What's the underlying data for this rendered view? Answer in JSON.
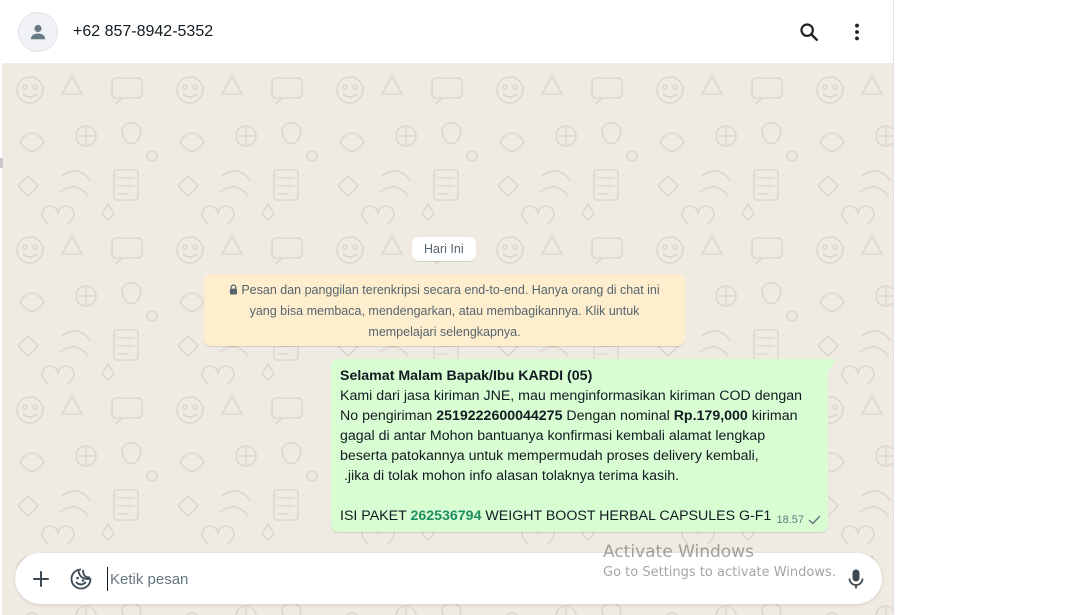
{
  "header": {
    "contact_name": "+62 857-8942-5352",
    "avatar_icon": "person-icon",
    "search_icon": "search-icon",
    "menu_icon": "more-vertical-icon"
  },
  "chat": {
    "date_chip": "Hari Ini",
    "encryption_notice": {
      "icon": "lock-icon",
      "line1": "Pesan dan panggilan terenkripsi secara end-to-end. Hanya orang di chat ini",
      "line2": "yang bisa membaca, mendengarkan, atau membagikannya. Klik untuk",
      "line3": "mempelajari selengkapnya."
    },
    "message": {
      "greeting": "Selamat Malam Bapak/Ibu KARDI (05)",
      "line2": "Kami dari jasa kiriman JNE, mau menginformasikan kiriman COD dengan",
      "line3_a": "No pengiriman ",
      "tracking_number": "2519222600044275",
      "line3_b": " Dengan nominal ",
      "amount": "Rp.179,000",
      "line3_c": " kiriman",
      "line4": "gagal di antar Mohon bantuanya konfirmasi kembali alamat lengkap",
      "line5": "beserta patokannya untuk mempermudah proses delivery kembali,",
      "line6": " .jika di tolak mohon info alasan tolaknya terima kasih.",
      "line8_a": "ISI PAKET ",
      "package_number": "262536794",
      "line8_b": " WEIGHT BOOST HERBAL CAPSULES G-F1",
      "time": "18.57",
      "status_icon": "single-check-icon"
    }
  },
  "composer": {
    "placeholder": "Ketik pesan",
    "attach_icon": "plus-icon",
    "sticker_icon": "sticker-icon",
    "mic_icon": "microphone-icon"
  },
  "watermark": {
    "title": "Activate Windows",
    "subtitle": "Go to Settings to activate Windows."
  },
  "colors": {
    "chat_background": "#efeae2",
    "outgoing_bubble": "#d9fdd3",
    "notice_background": "#ffeecd",
    "package_number": "#1f8f63"
  }
}
